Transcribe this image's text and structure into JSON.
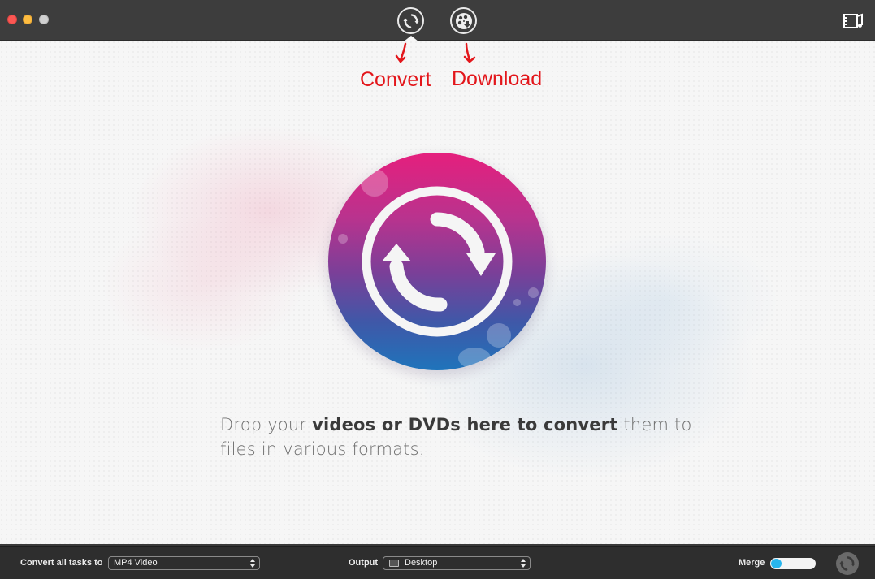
{
  "titlebar": {
    "window_controls": [
      "close",
      "minimize",
      "zoom"
    ],
    "modes": [
      {
        "id": "convert",
        "icon": "convert-arrows-icon",
        "active": true
      },
      {
        "id": "download",
        "icon": "film-reel-download-icon",
        "active": false
      }
    ],
    "toolbox_icon": "film-music-icon"
  },
  "annotations": {
    "convert": "Convert",
    "download": "Download",
    "color": "#e3161b"
  },
  "main": {
    "hero_icon": "convert-arrows-icon",
    "drop_text": {
      "prefix": "Drop your ",
      "bold": "videos or DVDs here to convert",
      "suffix": " them to files in various formats."
    }
  },
  "bottombar": {
    "convert_all_label": "Convert all tasks to",
    "format_value": "MP4 Video",
    "output_label": "Output",
    "output_value": "Desktop",
    "merge_label": "Merge",
    "merge_on": false,
    "start_icon": "convert-arrows-icon"
  },
  "colors": {
    "titlebar": "#3d3d3d",
    "bottombar": "#2e2e2e",
    "toggle_knob": "#27b6ee",
    "hero_top": "#e51f7d",
    "hero_bottom": "#1f74bb"
  }
}
